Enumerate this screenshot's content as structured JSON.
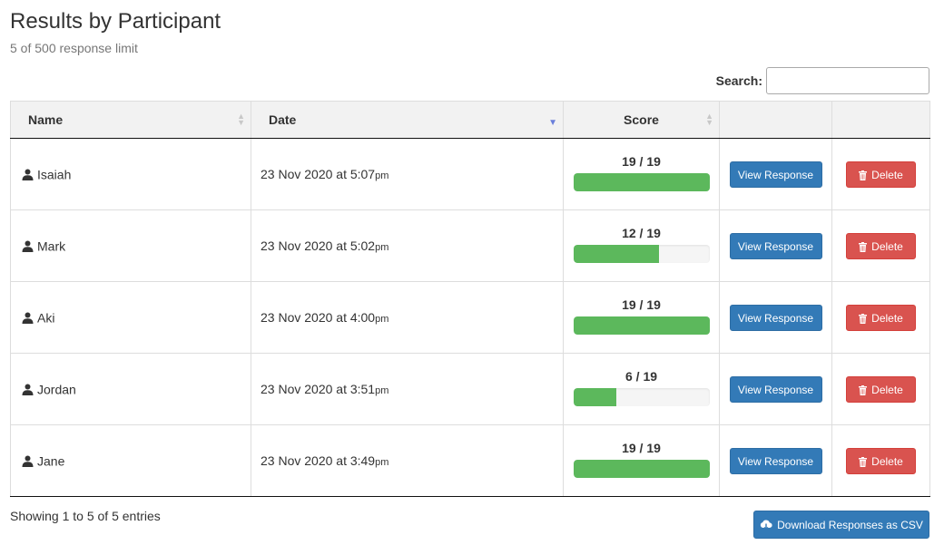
{
  "header": {
    "title": "Results by Participant",
    "subtitle": "5 of 500 response limit"
  },
  "search": {
    "label": "Search:",
    "value": "",
    "placeholder": ""
  },
  "table": {
    "columns": [
      {
        "label": "Name",
        "sortable": true,
        "sort_state": "none"
      },
      {
        "label": "Date",
        "sortable": true,
        "sort_state": "descending"
      },
      {
        "label": "Score",
        "sortable": true,
        "sort_state": "none"
      },
      {
        "label": ""
      },
      {
        "label": ""
      }
    ],
    "rows": [
      {
        "name": "Isaiah",
        "date": "23 Nov 2020 at 5:07",
        "ampm": "pm",
        "score_label": "19 / 19",
        "score": 19,
        "max": 19,
        "view_label": "View Response",
        "delete_label": "Delete"
      },
      {
        "name": "Mark",
        "date": "23 Nov 2020 at 5:02",
        "ampm": "pm",
        "score_label": "12 / 19",
        "score": 12,
        "max": 19,
        "view_label": "View Response",
        "delete_label": "Delete"
      },
      {
        "name": "Aki",
        "date": "23 Nov 2020 at 4:00",
        "ampm": "pm",
        "score_label": "19 / 19",
        "score": 19,
        "max": 19,
        "view_label": "View Response",
        "delete_label": "Delete"
      },
      {
        "name": "Jordan",
        "date": "23 Nov 2020 at 3:51",
        "ampm": "pm",
        "score_label": "6 / 19",
        "score": 6,
        "max": 19,
        "view_label": "View Response",
        "delete_label": "Delete"
      },
      {
        "name": "Jane",
        "date": "23 Nov 2020 at 3:49",
        "ampm": "pm",
        "score_label": "19 / 19",
        "score": 19,
        "max": 19,
        "view_label": "View Response",
        "delete_label": "Delete"
      }
    ]
  },
  "footer": {
    "showing": "Showing 1 to 5 of 5 entries",
    "download_label": "Download Responses as CSV"
  },
  "icons": {
    "participant": "user-icon",
    "delete": "trash-icon",
    "download": "cloud-download-icon",
    "sort": "sort-icon"
  },
  "colors": {
    "primary": "#337ab7",
    "danger": "#d9534f",
    "success": "#5cb85c",
    "sort_active": "#6a7fdb"
  }
}
